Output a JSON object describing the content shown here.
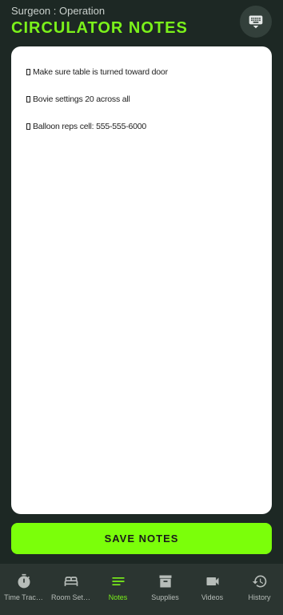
{
  "header": {
    "subtitle": "Surgeon : Operation",
    "title": "CIRCULATOR NOTES"
  },
  "keyboard_button": {
    "icon": "keyboard-icon"
  },
  "notes": [
    "Make sure table is turned toward door",
    "Bovie settings 20 across all",
    "Balloon reps cell: 555-555-6000"
  ],
  "save_button": {
    "label": "SAVE NOTES"
  },
  "nav": {
    "items": [
      {
        "label": "Time Trac…",
        "icon": "stopwatch-icon"
      },
      {
        "label": "Room Set…",
        "icon": "bed-icon"
      },
      {
        "label": "Notes",
        "icon": "notes-icon",
        "active": true
      },
      {
        "label": "Supplies",
        "icon": "archive-box-icon"
      },
      {
        "label": "Videos",
        "icon": "videocam-icon"
      },
      {
        "label": "History",
        "icon": "history-icon"
      }
    ]
  },
  "colors": {
    "background": "#1d2824",
    "accent": "#7bf21a",
    "button": "#7bff0a",
    "nav_background": "#2b3531"
  }
}
